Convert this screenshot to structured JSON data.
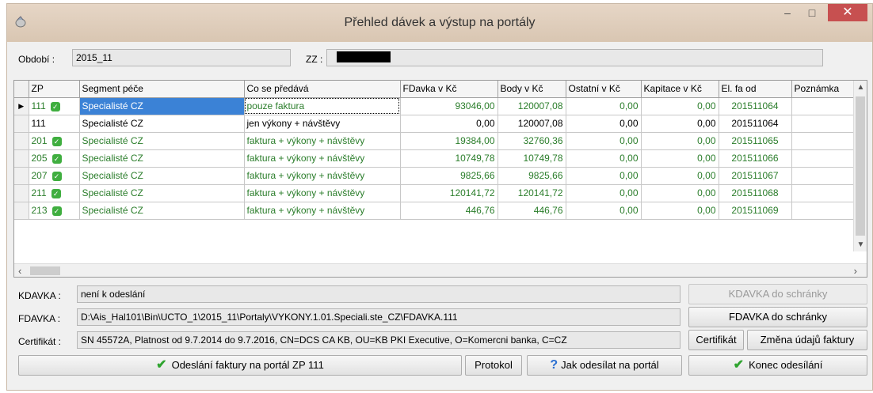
{
  "window": {
    "title": "Přehled dávek a výstup na portály",
    "controls": {
      "minimize": "–",
      "maximize": "□",
      "close": "✕"
    }
  },
  "period": {
    "label": "Období :",
    "value": "2015_11"
  },
  "zz": {
    "label": "ZZ :",
    "value": ""
  },
  "grid": {
    "columns": [
      "ZP",
      "Segment péče",
      "Co se předává",
      "FDavka v Kč",
      "Body v Kč",
      "Ostatní v Kč",
      "Kapitace v Kč",
      "El. fa od",
      "Poznámka"
    ],
    "rows": [
      {
        "zp": "111",
        "ok": true,
        "segment": "Specialisté CZ",
        "co": "pouze faktura",
        "fdavka": "93046,00",
        "body": "120007,08",
        "ostatni": "0,00",
        "kapitace": "0,00",
        "elfa": "201511064",
        "poznamka": ""
      },
      {
        "zp": "111",
        "ok": false,
        "segment": "Specialisté CZ",
        "co": "jen výkony + návštěvy",
        "fdavka": "0,00",
        "body": "120007,08",
        "ostatni": "0,00",
        "kapitace": "0,00",
        "elfa": "201511064",
        "poznamka": ""
      },
      {
        "zp": "201",
        "ok": true,
        "segment": "Specialisté CZ",
        "co": "faktura + výkony + návštěvy",
        "fdavka": "19384,00",
        "body": "32760,36",
        "ostatni": "0,00",
        "kapitace": "0,00",
        "elfa": "201511065",
        "poznamka": ""
      },
      {
        "zp": "205",
        "ok": true,
        "segment": "Specialisté CZ",
        "co": "faktura + výkony + návštěvy",
        "fdavka": "10749,78",
        "body": "10749,78",
        "ostatni": "0,00",
        "kapitace": "0,00",
        "elfa": "201511066",
        "poznamka": ""
      },
      {
        "zp": "207",
        "ok": true,
        "segment": "Specialisté CZ",
        "co": "faktura + výkony + návštěvy",
        "fdavka": "9825,66",
        "body": "9825,66",
        "ostatni": "0,00",
        "kapitace": "0,00",
        "elfa": "201511067",
        "poznamka": ""
      },
      {
        "zp": "211",
        "ok": true,
        "segment": "Specialisté CZ",
        "co": "faktura + výkony + návštěvy",
        "fdavka": "120141,72",
        "body": "120141,72",
        "ostatni": "0,00",
        "kapitace": "0,00",
        "elfa": "201511068",
        "poznamka": ""
      },
      {
        "zp": "213",
        "ok": true,
        "segment": "Specialisté CZ",
        "co": "faktura + výkony + návštěvy",
        "fdavka": "446,76",
        "body": "446,76",
        "ostatni": "0,00",
        "kapitace": "0,00",
        "elfa": "201511069",
        "poznamka": ""
      }
    ]
  },
  "kdavka": {
    "label": "KDAVKA :",
    "value": "není k odeslání",
    "button": "KDAVKA do schránky"
  },
  "fdavka": {
    "label": "FDAVKA :",
    "value": "D:\\Ais_Hal101\\Bin\\UCTO_1\\2015_11\\Portaly\\VYKONY.1.01.Speciali.ste_CZ\\FDAVKA.111",
    "button": "FDAVKA do schránky"
  },
  "cert": {
    "label": "Certifikát :",
    "value": "SN 45572A, Platnost od 9.7.2014 do 9.7.2016, CN=DCS CA KB, OU=KB PKI Executive, O=Komercni banka, C=CZ",
    "button": "Certifikát",
    "change_button": "Změna údajů faktury"
  },
  "actions": {
    "send": "Odeslání faktury na portál ZP 111",
    "protocol": "Protokol",
    "howto": "Jak odesílat na portál",
    "finish": "Konec odesílání"
  },
  "colors": {
    "green_text": "#2a7d2a",
    "selection": "#3b82d6",
    "close_button": "#c75050"
  }
}
